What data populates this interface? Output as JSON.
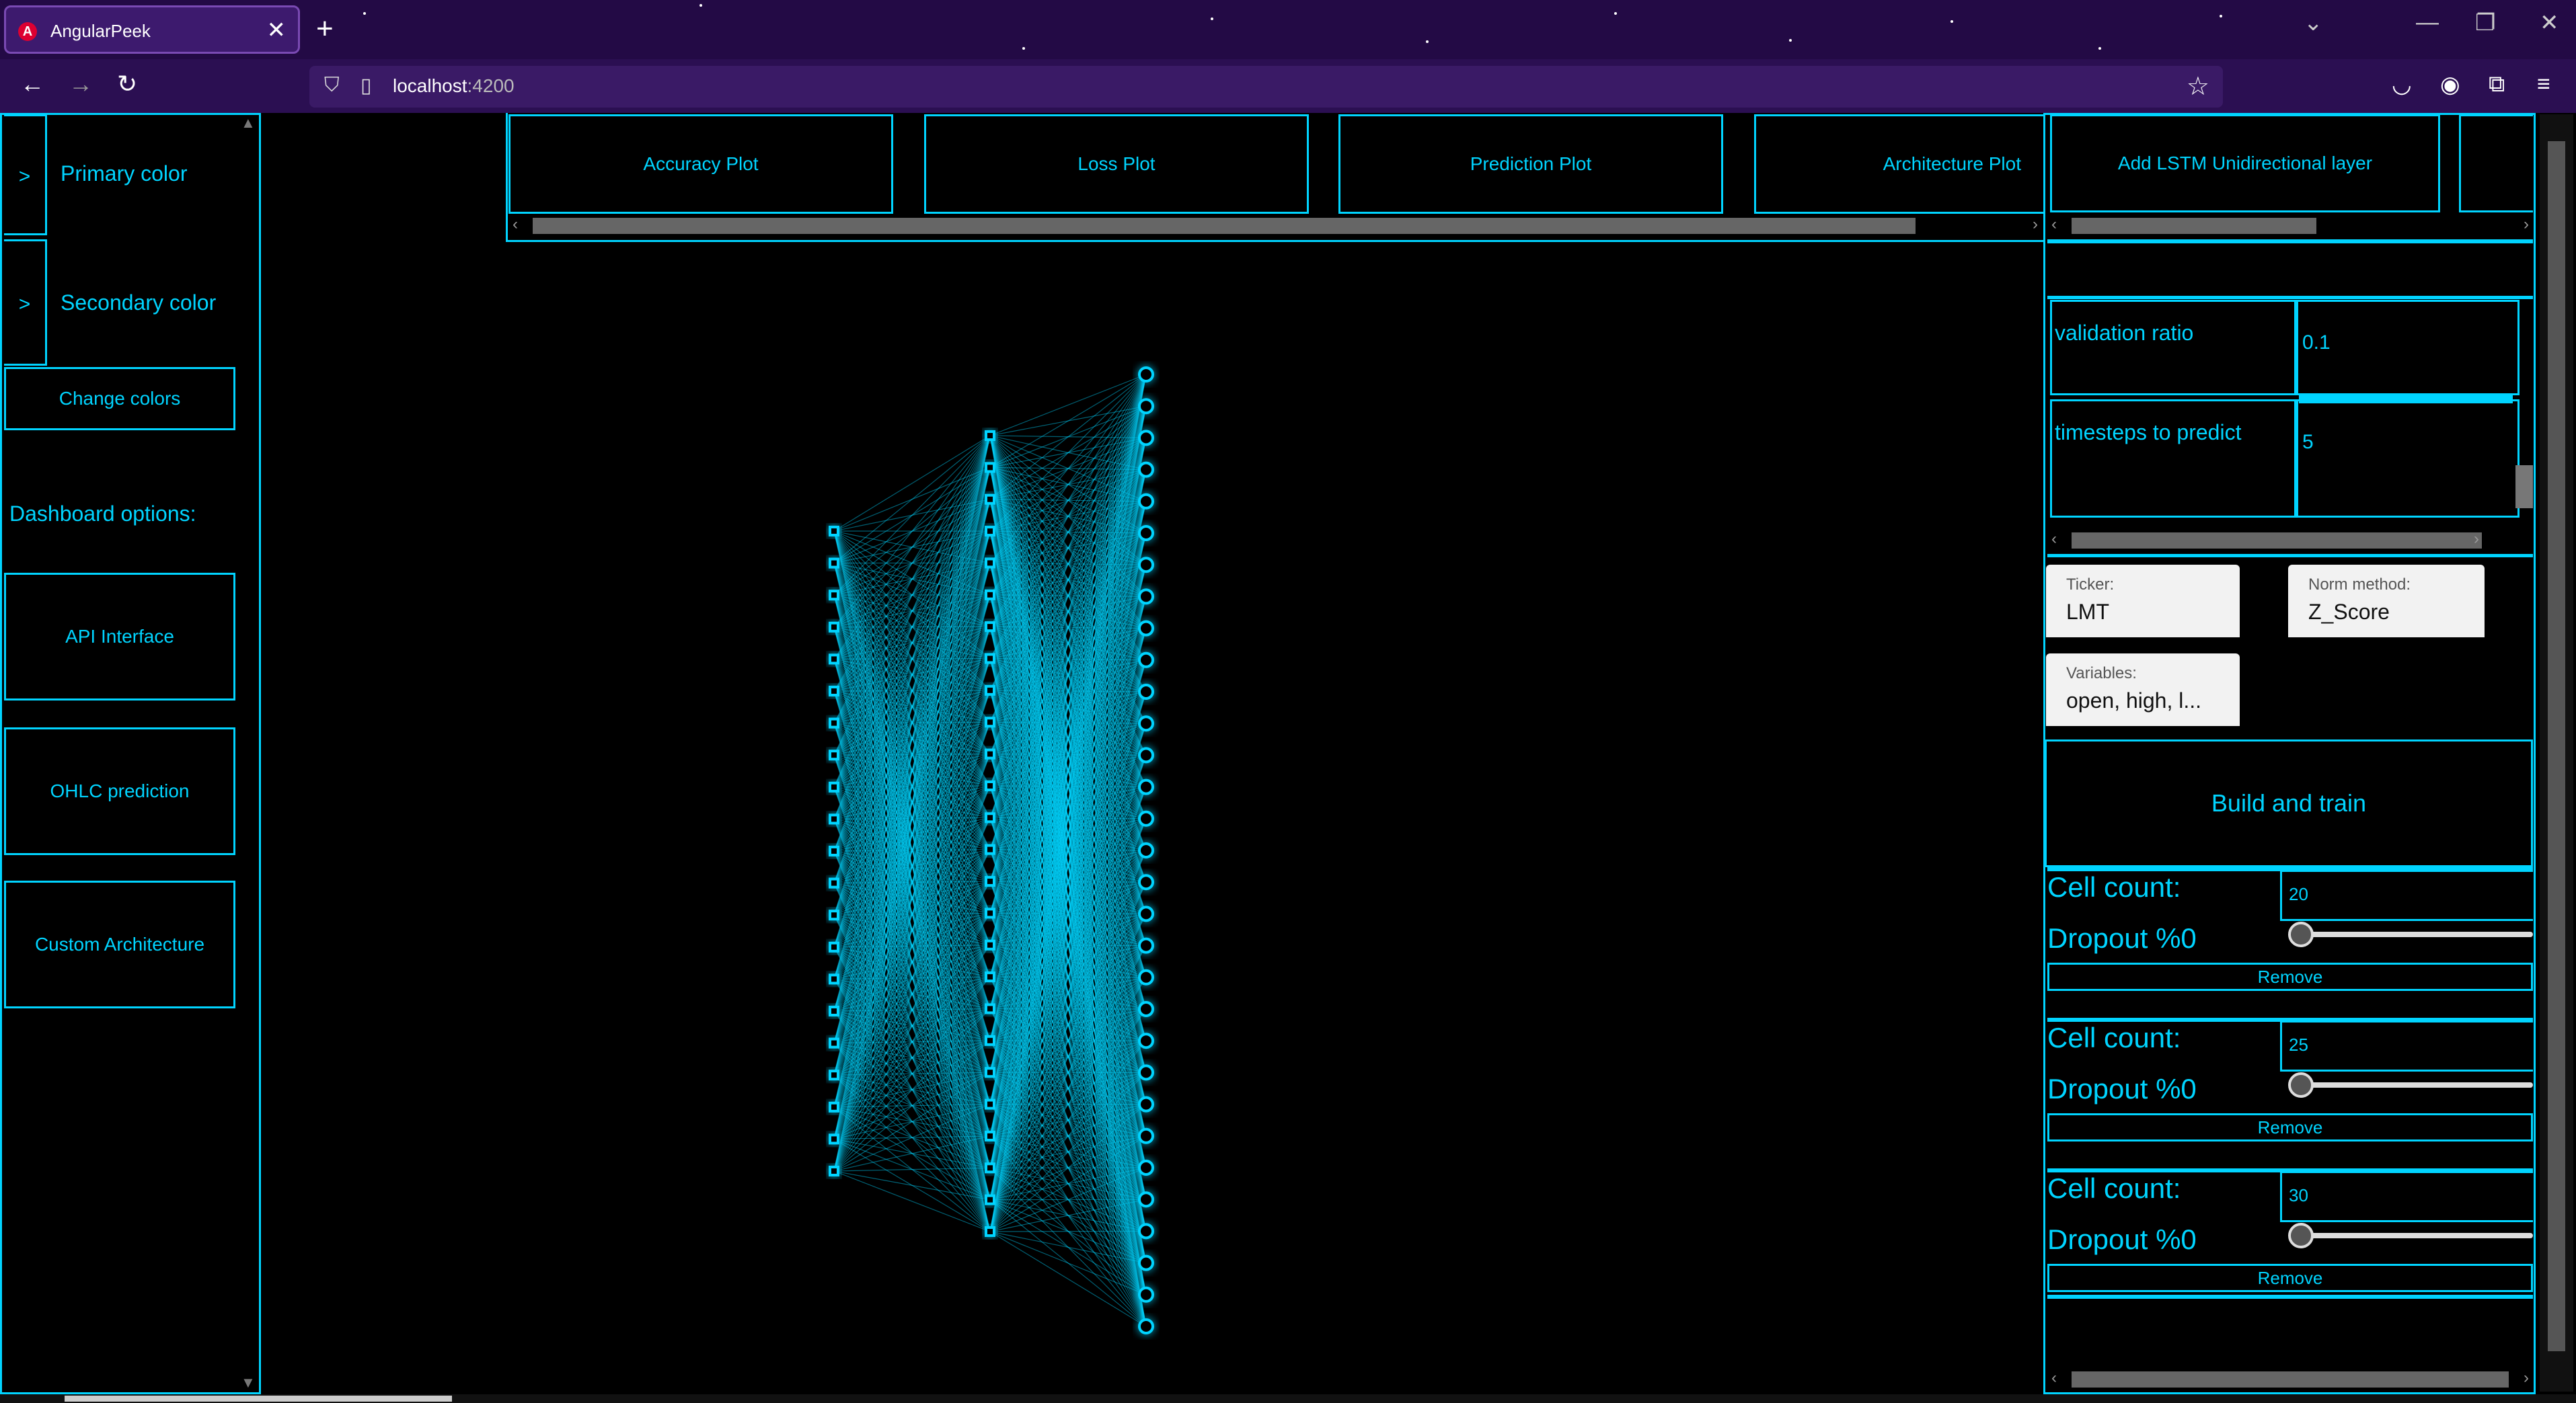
{
  "browser": {
    "tab_title": "AngularPeek",
    "tab_close": "✕",
    "new_tab": "+",
    "url_host": "localhost",
    "url_port": ":4200",
    "back": "←",
    "forward": "→",
    "reload": "↻",
    "bookmark": "☆",
    "minimize": "—",
    "restore": "❐",
    "close": "✕",
    "tabs_dropdown": "⌄",
    "menu": "≡"
  },
  "sidebar": {
    "expander": ">",
    "primary_color_label": "Primary color",
    "secondary_color_label": "Secondary color",
    "change_colors": "Change colors",
    "dashboard_heading": "Dashboard options:",
    "options": [
      "API Interface",
      "OHLC prediction",
      "Custom Architecture"
    ]
  },
  "plot_tabs": [
    "Accuracy Plot",
    "Loss Plot",
    "Prediction Plot",
    "Architecture Plot"
  ],
  "right_panel": {
    "add_layer": "Add LSTM Unidirectional layer",
    "params": [
      {
        "label": "validation ratio",
        "value": "0.1"
      },
      {
        "label": "timesteps to predict",
        "value": "5"
      }
    ],
    "ticker": {
      "label": "Ticker:",
      "value": "LMT"
    },
    "norm_method": {
      "label": "Norm method:",
      "value": "Z_Score"
    },
    "variables": {
      "label": "Variables:",
      "value": "open, high, l..."
    },
    "build_train": "Build and train",
    "layers": [
      {
        "cell_label": "Cell count:",
        "cell_value": "20",
        "dropout_label": "Dropout %0",
        "dropout_value": 0,
        "remove": "Remove"
      },
      {
        "cell_label": "Cell count:",
        "cell_value": "25",
        "dropout_label": "Dropout %0",
        "dropout_value": 0,
        "remove": "Remove"
      },
      {
        "cell_label": "Cell count:",
        "cell_value": "30",
        "dropout_label": "Dropout %0",
        "dropout_value": 0,
        "remove": "Remove"
      }
    ]
  },
  "network": {
    "layer_sizes": [
      21,
      26,
      31
    ],
    "color": "#00d4ff"
  },
  "colors": {
    "accent": "#00d4ff",
    "chrome": "#2b0f52",
    "background": "#000000"
  }
}
